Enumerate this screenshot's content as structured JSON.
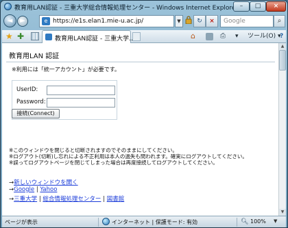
{
  "window": {
    "title": "教育用LAN認証 - 三重大学総合情報処理センター - Windows Internet Explorer",
    "minimize": "–",
    "maximize": "□",
    "close": "×"
  },
  "addressbar": {
    "back_glyph": "◄",
    "forward_glyph": "►",
    "url_icon": "e",
    "url": "https://e1s.elan1.mie-u.ac.jp/",
    "dropdown_glyph": "▼",
    "lock_icon": "lock-icon",
    "refresh_glyph": "↻",
    "stop_glyph": "×",
    "search_placeholder": "Google",
    "search_glyph": "⌕"
  },
  "commandbar": {
    "tab_title": "教育用LAN認証 - 三重大学...",
    "page_menu_glyph": "▾",
    "tools_menu": "ツール(O) ▾",
    "help_glyph": "?"
  },
  "page": {
    "title": "教育用LAN 認証",
    "note": "※利用には「統一アカウント」が必要です。",
    "userid_label": "UserID:",
    "userid_value": "",
    "password_label": "Password:",
    "password_value": "",
    "connect_button": "接続(Connect)",
    "notices": [
      "※このウィンドウを閉じると切断されますのでそのままにしてください。",
      "※ログアウト(切断)し忘れによる不正利用は本人の過失も問われます。確実にログアウトしてください。",
      "※誤ってログアウトページを閉じてしまった場合は再度接続してログアウトしてください。"
    ],
    "arrow": "→",
    "separator": "|",
    "links": {
      "new_window": "新しいウィンドウを開く",
      "google": "Google",
      "yahoo": "Yahoo",
      "mie_university": "三重大学",
      "info_center": "総合情報処理センター",
      "library": "図書館"
    }
  },
  "statusbar": {
    "status": "ページが表示",
    "zone": "インターネット | 保護モード: 有効",
    "zoom": "100%",
    "zoom_dropdown_glyph": "▼"
  },
  "colors": {
    "link": "#1a3bd9",
    "frame": "#6f9cb8",
    "close_button": "#c2391e"
  }
}
